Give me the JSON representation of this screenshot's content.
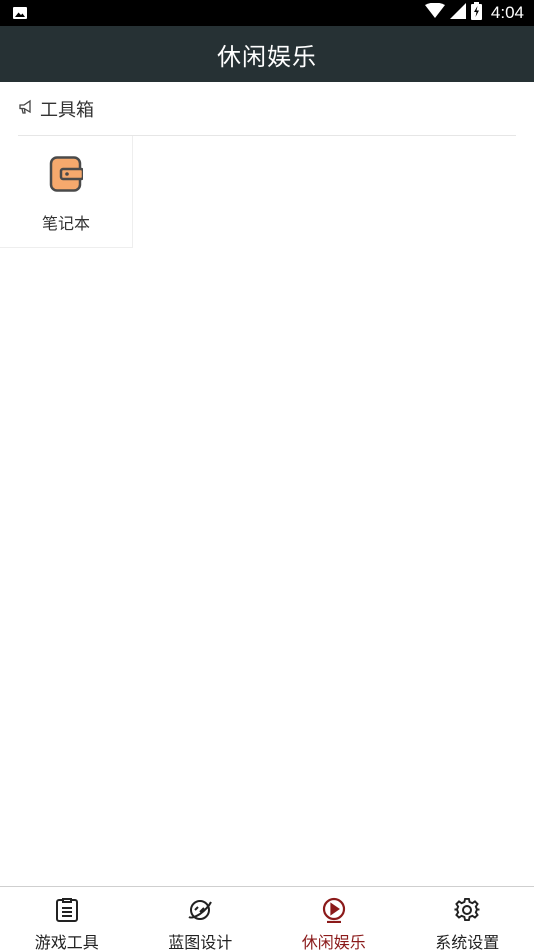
{
  "status_bar": {
    "time": "4:04"
  },
  "app_bar": {
    "title": "休闲娱乐"
  },
  "section": {
    "title": "工具箱"
  },
  "tools": [
    {
      "label": "笔记本",
      "icon": "notebook-icon"
    }
  ],
  "bottom_nav": [
    {
      "label": "游戏工具",
      "icon": "clipboard-icon",
      "active": false
    },
    {
      "label": "蓝图设计",
      "icon": "planet-icon",
      "active": false
    },
    {
      "label": "休闲娱乐",
      "icon": "play-icon",
      "active": true
    },
    {
      "label": "系统设置",
      "icon": "gear-icon",
      "active": false
    }
  ],
  "colors": {
    "app_bar": "#263134",
    "active_tab": "#8b1a1a",
    "notebook_fill": "#f6a96d"
  }
}
